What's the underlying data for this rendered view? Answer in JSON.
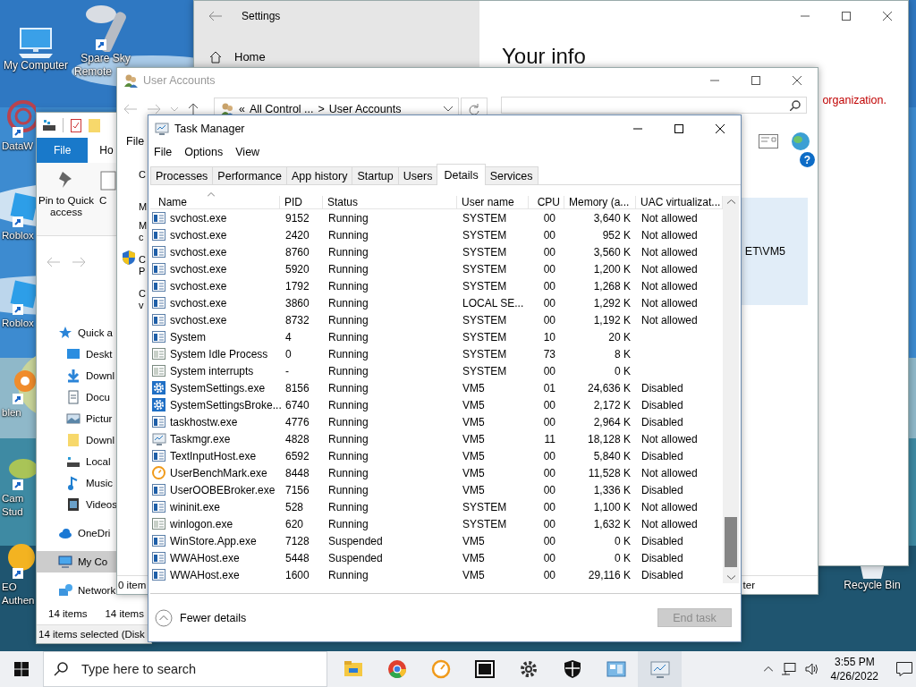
{
  "desktop": {
    "icons": [
      {
        "kind": "computer",
        "lines": [
          "My Computer"
        ],
        "shortcut": false
      },
      {
        "kind": "remote",
        "lines": [
          "Spare Sky",
          "Remote"
        ],
        "shortcut": true
      },
      {
        "kind": "web",
        "lines": [
          "DataW"
        ],
        "shortcut": true
      },
      {
        "kind": "roblox",
        "lines": [
          "Roblox"
        ],
        "shortcut": true
      },
      {
        "kind": "roblox",
        "lines": [
          "Roblox"
        ],
        "shortcut": true
      },
      {
        "kind": "blender",
        "lines": [
          "blen"
        ],
        "shortcut": true
      },
      {
        "kind": "studio",
        "lines": [
          "Cam",
          "Stud"
        ],
        "shortcut": true
      },
      {
        "kind": "sun",
        "lines": [
          "EO",
          "Authen"
        ],
        "shortcut": true
      },
      {
        "kind": "bin",
        "lines": [
          "Recycle Bin"
        ],
        "shortcut": false
      }
    ]
  },
  "settings": {
    "title": "Settings",
    "nav_item": "Home",
    "heading": "Your info",
    "note": "organization."
  },
  "explorer": {
    "tabs": [
      {
        "label": "File",
        "selected": true
      },
      {
        "label": "Ho",
        "selected": false
      }
    ],
    "ribbon": [
      {
        "kind": "pin",
        "label": "Pin to Quick access"
      },
      {
        "kind": "copy",
        "label": "C"
      }
    ],
    "nav": [
      {
        "kind": "star",
        "label": "Quick a",
        "selected": false,
        "children": [
          {
            "kind": "desktop",
            "label": "Deskt",
            "selected": false
          },
          {
            "kind": "download",
            "label": "Downl",
            "selected": false
          },
          {
            "kind": "document",
            "label": "Docu",
            "selected": false
          },
          {
            "kind": "pictures",
            "label": "Pictur",
            "selected": false
          },
          {
            "kind": "folder",
            "label": "Downl",
            "selected": false
          },
          {
            "kind": "drive",
            "label": "Local",
            "selected": false
          },
          {
            "kind": "music",
            "label": "Music",
            "selected": false
          },
          {
            "kind": "videos",
            "label": "Videos",
            "selected": false
          }
        ]
      },
      {
        "kind": "cloud",
        "label": "OneDri",
        "selected": false
      },
      {
        "kind": "pc",
        "label": "My Co",
        "selected": true
      },
      {
        "kind": "network",
        "label": "Network",
        "selected": false
      }
    ],
    "status": [
      "14 items",
      "14 items"
    ],
    "selection": "14 items selected (Disk"
  },
  "user_accounts": {
    "title": "User Accounts",
    "breadcrumb": [
      "«",
      "All Control ...",
      ">",
      "User Accounts"
    ],
    "menu": [
      "File"
    ],
    "fragments": [
      {
        "lines": [
          "C"
        ]
      },
      {
        "lines": [
          "M"
        ]
      },
      {
        "lines": [
          "M",
          "c"
        ]
      },
      {
        "lines": [
          "C",
          "P"
        ]
      },
      {
        "lines": [
          "C",
          "v"
        ]
      }
    ],
    "help": "?",
    "panel_text": "ET\\VM5",
    "status_left": "0 item",
    "status_right": "ter"
  },
  "task_manager": {
    "title": "Task Manager",
    "menu": [
      "File",
      "Options",
      "View"
    ],
    "tabs": [
      {
        "label": "Processes",
        "selected": false
      },
      {
        "label": "Performance",
        "selected": false
      },
      {
        "label": "App history",
        "selected": false
      },
      {
        "label": "Startup",
        "selected": false
      },
      {
        "label": "Users",
        "selected": false
      },
      {
        "label": "Details",
        "selected": true
      },
      {
        "label": "Services",
        "selected": false
      }
    ],
    "columns": [
      {
        "label": "Name",
        "sorted": true
      },
      {
        "label": "PID",
        "sorted": false
      },
      {
        "label": "Status",
        "sorted": false
      },
      {
        "label": "User name",
        "sorted": false
      },
      {
        "label": "CPU",
        "sorted": false
      },
      {
        "label": "Memory (a...",
        "sorted": false
      },
      {
        "label": "UAC virtualizat...",
        "sorted": false
      }
    ],
    "rows": [
      {
        "kind": "app",
        "name": "svchost.exe",
        "pid": "9152",
        "status": "Running",
        "user": "SYSTEM",
        "cpu": "00",
        "memory": "3,640 K",
        "uac": "Not allowed"
      },
      {
        "kind": "app",
        "name": "svchost.exe",
        "pid": "2420",
        "status": "Running",
        "user": "SYSTEM",
        "cpu": "00",
        "memory": "952 K",
        "uac": "Not allowed"
      },
      {
        "kind": "app",
        "name": "svchost.exe",
        "pid": "8760",
        "status": "Running",
        "user": "SYSTEM",
        "cpu": "00",
        "memory": "3,560 K",
        "uac": "Not allowed"
      },
      {
        "kind": "app",
        "name": "svchost.exe",
        "pid": "5920",
        "status": "Running",
        "user": "SYSTEM",
        "cpu": "00",
        "memory": "1,200 K",
        "uac": "Not allowed"
      },
      {
        "kind": "app",
        "name": "svchost.exe",
        "pid": "1792",
        "status": "Running",
        "user": "SYSTEM",
        "cpu": "00",
        "memory": "1,268 K",
        "uac": "Not allowed"
      },
      {
        "kind": "app",
        "name": "svchost.exe",
        "pid": "3860",
        "status": "Running",
        "user": "LOCAL SE...",
        "cpu": "00",
        "memory": "1,292 K",
        "uac": "Not allowed"
      },
      {
        "kind": "app",
        "name": "svchost.exe",
        "pid": "8732",
        "status": "Running",
        "user": "SYSTEM",
        "cpu": "00",
        "memory": "1,192 K",
        "uac": "Not allowed"
      },
      {
        "kind": "app",
        "name": "System",
        "pid": "4",
        "status": "Running",
        "user": "SYSTEM",
        "cpu": "10",
        "memory": "20 K"
      },
      {
        "kind": "system",
        "name": "System Idle Process",
        "pid": "0",
        "status": "Running",
        "user": "SYSTEM",
        "cpu": "73",
        "memory": "8 K"
      },
      {
        "kind": "system",
        "name": "System interrupts",
        "pid": "-",
        "status": "Running",
        "user": "SYSTEM",
        "cpu": "00",
        "memory": "0 K"
      },
      {
        "kind": "gear",
        "name": "SystemSettings.exe",
        "pid": "8156",
        "status": "Running",
        "user": "VM5",
        "cpu": "01",
        "memory": "24,636 K",
        "uac": "Disabled"
      },
      {
        "kind": "gear",
        "name": "SystemSettingsBroke...",
        "pid": "6740",
        "status": "Running",
        "user": "VM5",
        "cpu": "00",
        "memory": "2,172 K",
        "uac": "Disabled"
      },
      {
        "kind": "app",
        "name": "taskhostw.exe",
        "pid": "4776",
        "status": "Running",
        "user": "VM5",
        "cpu": "00",
        "memory": "2,964 K",
        "uac": "Disabled"
      },
      {
        "kind": "monitor",
        "name": "Taskmgr.exe",
        "pid": "4828",
        "status": "Running",
        "user": "VM5",
        "cpu": "11",
        "memory": "18,128 K",
        "uac": "Not allowed"
      },
      {
        "kind": "app",
        "name": "TextInputHost.exe",
        "pid": "6592",
        "status": "Running",
        "user": "VM5",
        "cpu": "00",
        "memory": "5,840 K",
        "uac": "Disabled"
      },
      {
        "kind": "clock",
        "name": "UserBenchMark.exe",
        "pid": "8448",
        "status": "Running",
        "user": "VM5",
        "cpu": "00",
        "memory": "11,528 K",
        "uac": "Not allowed"
      },
      {
        "kind": "app",
        "name": "UserOOBEBroker.exe",
        "pid": "7156",
        "status": "Running",
        "user": "VM5",
        "cpu": "00",
        "memory": "1,336 K",
        "uac": "Disabled"
      },
      {
        "kind": "app",
        "name": "wininit.exe",
        "pid": "528",
        "status": "Running",
        "user": "SYSTEM",
        "cpu": "00",
        "memory": "1,100 K",
        "uac": "Not allowed"
      },
      {
        "kind": "system",
        "name": "winlogon.exe",
        "pid": "620",
        "status": "Running",
        "user": "SYSTEM",
        "cpu": "00",
        "memory": "1,632 K",
        "uac": "Not allowed"
      },
      {
        "kind": "app",
        "name": "WinStore.App.exe",
        "pid": "7128",
        "status": "Suspended",
        "user": "VM5",
        "cpu": "00",
        "memory": "0 K",
        "uac": "Disabled"
      },
      {
        "kind": "app",
        "name": "WWAHost.exe",
        "pid": "5448",
        "status": "Suspended",
        "user": "VM5",
        "cpu": "00",
        "memory": "0 K",
        "uac": "Disabled"
      },
      {
        "kind": "app",
        "name": "WWAHost.exe",
        "pid": "1600",
        "status": "Running",
        "user": "VM5",
        "cpu": "00",
        "memory": "29,116 K",
        "uac": "Disabled"
      }
    ],
    "details_toggle": "Fewer details",
    "end_task": {
      "label": "End task",
      "disabled": true
    }
  },
  "taskbar": {
    "search": {
      "placeholder": "Type here to search"
    },
    "apps": [
      {
        "kind": "folder",
        "active": false
      },
      {
        "kind": "chrome",
        "active": false
      },
      {
        "kind": "clock",
        "active": false
      },
      {
        "kind": "zip",
        "active": false
      },
      {
        "kind": "gear",
        "active": false
      },
      {
        "kind": "shield",
        "active": false
      },
      {
        "kind": "panel",
        "active": false
      },
      {
        "kind": "monitor",
        "active": true
      }
    ],
    "time": "3:55 PM",
    "date": "4/26/2022"
  }
}
